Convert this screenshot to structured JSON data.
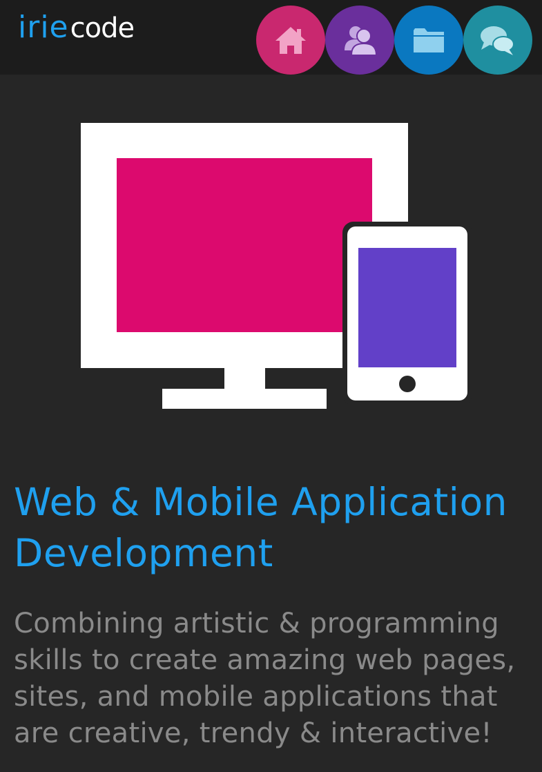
{
  "brand": {
    "logo_primary": "irie",
    "logo_secondary": "code",
    "primary_color": "#1fa0ef",
    "secondary_color": "#ffffff"
  },
  "nav": {
    "items": [
      {
        "icon": "home-icon",
        "color": "#c9286f"
      },
      {
        "icon": "users-icon",
        "color": "#6a2f9c"
      },
      {
        "icon": "folder-icon",
        "color": "#0a78c0"
      },
      {
        "icon": "chat-icon",
        "color": "#1f8fa0"
      }
    ]
  },
  "hero": {
    "icon": "devices-icon",
    "screen_color": "#dc0a6e",
    "tablet_screen_color": "#6240c8",
    "frame_color": "#ffffff"
  },
  "content": {
    "headline": "Web & Mobile Application Development",
    "description": "Combining artistic & programming skills to create amazing web pages, sites, and mobile applications that are creative, trendy & interactive!"
  }
}
